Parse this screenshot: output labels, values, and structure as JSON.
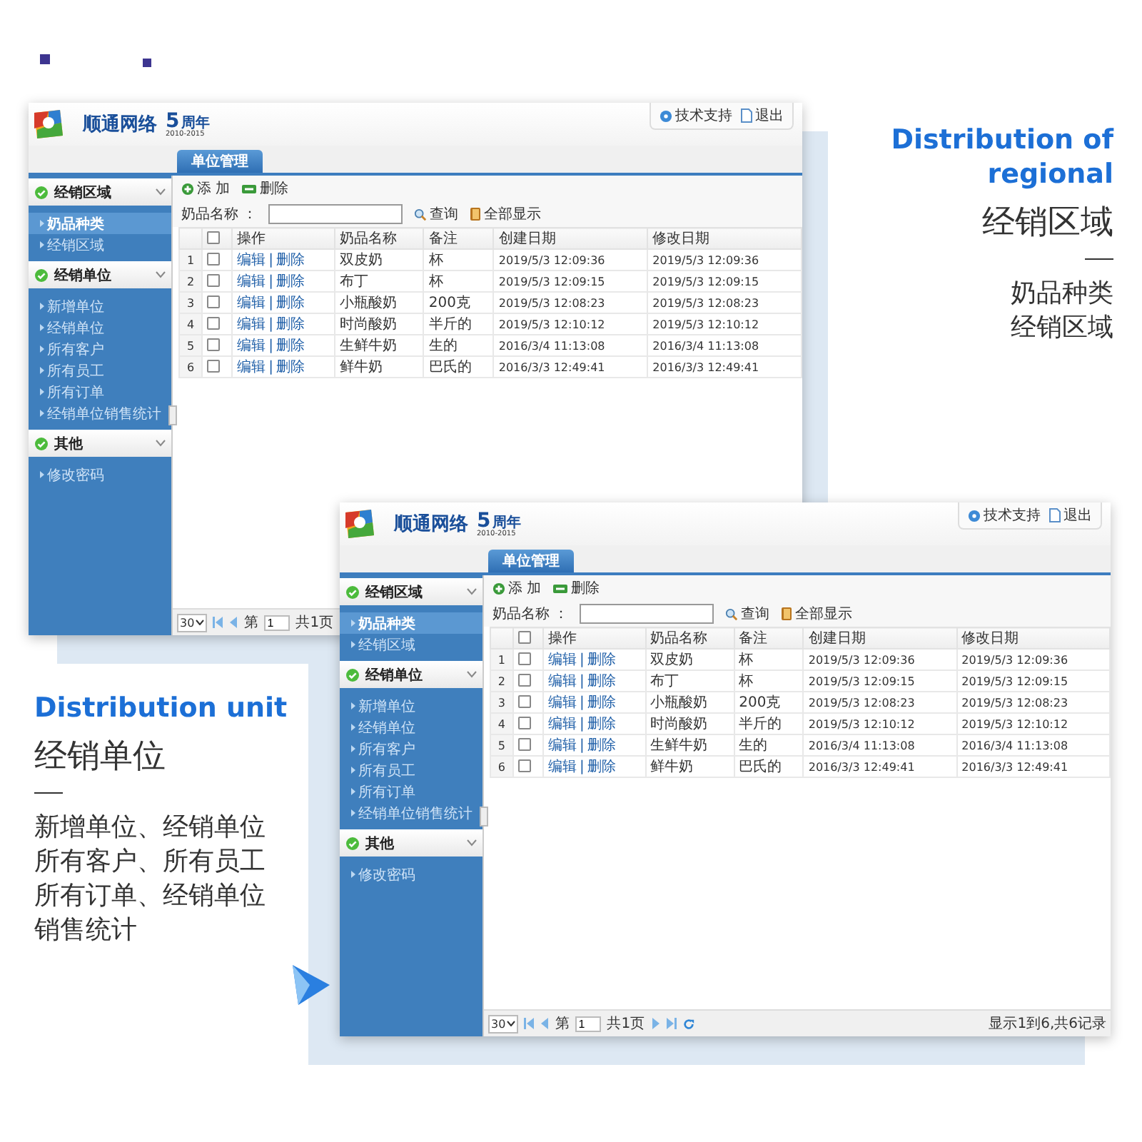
{
  "windows": [
    {
      "brand": {
        "name": "顺通网络",
        "number": "5",
        "label": "周年",
        "years": "2010-2015"
      },
      "header_links": [
        {
          "kind": "help",
          "label": "技术支持"
        },
        {
          "kind": "exit",
          "label": "退出"
        }
      ],
      "tabs": [
        {
          "label": "单位管理",
          "selected": true
        }
      ],
      "sidebar": [
        {
          "title": "经销区域",
          "expanded": true,
          "items": [
            {
              "label": "奶品种类",
              "selected": true
            },
            {
              "label": "经销区域",
              "selected": false
            }
          ]
        },
        {
          "title": "经销单位",
          "expanded": true,
          "items": [
            {
              "label": "新增单位",
              "selected": false
            },
            {
              "label": "经销单位",
              "selected": false
            },
            {
              "label": "所有客户",
              "selected": false
            },
            {
              "label": "所有员工",
              "selected": false
            },
            {
              "label": "所有订单",
              "selected": false
            },
            {
              "label": "经销单位销售统计",
              "selected": false
            }
          ]
        },
        {
          "title": "其他",
          "expanded": true,
          "items": [
            {
              "label": "修改密码",
              "selected": false
            }
          ]
        }
      ],
      "toolbar": {
        "buttons": [
          {
            "kind": "add",
            "label": "添 加"
          },
          {
            "kind": "delete",
            "label": "删除"
          }
        ],
        "search_label": "奶品名称 ：",
        "search_buttons": [
          {
            "kind": "search",
            "label": "查询"
          },
          {
            "kind": "show_all",
            "label": "全部显示"
          }
        ]
      },
      "table": {
        "columns": [
          "操作",
          "奶品名称",
          "备注",
          "创建日期",
          "修改日期"
        ],
        "header_checked": false,
        "action_separator": "|",
        "rows": [
          {
            "number": "1",
            "checked": false,
            "actions": [
              "编辑",
              "删除"
            ],
            "name": "双皮奶",
            "note": "杯",
            "created": "2019/5/3 12:09:36",
            "modified": "2019/5/3 12:09:36"
          },
          {
            "number": "2",
            "checked": false,
            "actions": [
              "编辑",
              "删除"
            ],
            "name": "布丁",
            "note": "杯",
            "created": "2019/5/3 12:09:15",
            "modified": "2019/5/3 12:09:15"
          },
          {
            "number": "3",
            "checked": false,
            "actions": [
              "编辑",
              "删除"
            ],
            "name": "小瓶酸奶",
            "note": "200克",
            "created": "2019/5/3 12:08:23",
            "modified": "2019/5/3 12:08:23"
          },
          {
            "number": "4",
            "checked": false,
            "actions": [
              "编辑",
              "删除"
            ],
            "name": "时尚酸奶",
            "note": "半斤的",
            "created": "2019/5/3 12:10:12",
            "modified": "2019/5/3 12:10:12"
          },
          {
            "number": "5",
            "checked": false,
            "actions": [
              "编辑",
              "删除"
            ],
            "name": "生鲜牛奶",
            "note": "生的",
            "created": "2016/3/4 11:13:08",
            "modified": "2016/3/4 11:13:08"
          },
          {
            "number": "6",
            "checked": false,
            "actions": [
              "编辑",
              "删除"
            ],
            "name": "鲜牛奶",
            "note": "巴氏的",
            "created": "2016/3/3 12:49:41",
            "modified": "2016/3/3 12:49:41"
          }
        ]
      },
      "footer": [
        {
          "kind": "page_size",
          "value": "30"
        },
        {
          "kind": "first"
        },
        {
          "kind": "prev"
        },
        {
          "kind": "page",
          "label": "第",
          "value": "1",
          "total": "共1页"
        }
      ]
    },
    {
      "brand": {
        "name": "顺通网络",
        "number": "5",
        "label": "周年",
        "years": "2010-2015"
      },
      "header_links": [
        {
          "kind": "help",
          "label": "技术支持"
        },
        {
          "kind": "exit",
          "label": "退出"
        }
      ],
      "tabs": [
        {
          "label": "单位管理",
          "selected": true
        }
      ],
      "sidebar": [
        {
          "title": "经销区域",
          "expanded": true,
          "items": [
            {
              "label": "奶品种类",
              "selected": true
            },
            {
              "label": "经销区域",
              "selected": false
            }
          ]
        },
        {
          "title": "经销单位",
          "expanded": true,
          "items": [
            {
              "label": "新增单位",
              "selected": false
            },
            {
              "label": "经销单位",
              "selected": false
            },
            {
              "label": "所有客户",
              "selected": false
            },
            {
              "label": "所有员工",
              "selected": false
            },
            {
              "label": "所有订单",
              "selected": false
            },
            {
              "label": "经销单位销售统计",
              "selected": false
            }
          ]
        },
        {
          "title": "其他",
          "expanded": true,
          "items": [
            {
              "label": "修改密码",
              "selected": false
            }
          ]
        }
      ],
      "toolbar": {
        "buttons": [
          {
            "kind": "add",
            "label": "添 加"
          },
          {
            "kind": "delete",
            "label": "删除"
          }
        ],
        "search_label": "奶品名称 ：",
        "search_buttons": [
          {
            "kind": "search",
            "label": "查询"
          },
          {
            "kind": "show_all",
            "label": "全部显示"
          }
        ]
      },
      "table": {
        "columns": [
          "操作",
          "奶品名称",
          "备注",
          "创建日期",
          "修改日期"
        ],
        "header_checked": false,
        "action_separator": "|",
        "rows": [
          {
            "number": "1",
            "checked": false,
            "actions": [
              "编辑",
              "删除"
            ],
            "name": "双皮奶",
            "note": "杯",
            "created": "2019/5/3 12:09:36",
            "modified": "2019/5/3 12:09:36"
          },
          {
            "number": "2",
            "checked": false,
            "actions": [
              "编辑",
              "删除"
            ],
            "name": "布丁",
            "note": "杯",
            "created": "2019/5/3 12:09:15",
            "modified": "2019/5/3 12:09:15"
          },
          {
            "number": "3",
            "checked": false,
            "actions": [
              "编辑",
              "删除"
            ],
            "name": "小瓶酸奶",
            "note": "200克",
            "created": "2019/5/3 12:08:23",
            "modified": "2019/5/3 12:08:23"
          },
          {
            "number": "4",
            "checked": false,
            "actions": [
              "编辑",
              "删除"
            ],
            "name": "时尚酸奶",
            "note": "半斤的",
            "created": "2019/5/3 12:10:12",
            "modified": "2019/5/3 12:10:12"
          },
          {
            "number": "5",
            "checked": false,
            "actions": [
              "编辑",
              "删除"
            ],
            "name": "生鲜牛奶",
            "note": "生的",
            "created": "2016/3/4 11:13:08",
            "modified": "2016/3/4 11:13:08"
          },
          {
            "number": "6",
            "checked": false,
            "actions": [
              "编辑",
              "删除"
            ],
            "name": "鲜牛奶",
            "note": "巴氏的",
            "created": "2016/3/3 12:49:41",
            "modified": "2016/3/3 12:49:41"
          }
        ]
      },
      "footer": [
        {
          "kind": "page_size",
          "value": "30"
        },
        {
          "kind": "first"
        },
        {
          "kind": "prev"
        },
        {
          "kind": "page",
          "label": "第",
          "value": "1",
          "total": "共1页"
        },
        {
          "kind": "next"
        },
        {
          "kind": "last"
        },
        {
          "kind": "refresh"
        },
        {
          "kind": "summary",
          "text": "显示1到6,共6记录"
        }
      ]
    }
  ],
  "captions": [
    {
      "title": "Distribution of regional",
      "subtitle": "经销区域",
      "lines": [
        "奶品种类",
        "经销区域"
      ]
    },
    {
      "title": "Distribution unit",
      "subtitle": "经销单位",
      "lines": [
        "新增单位、经销单位",
        "所有客户、所有员工",
        "所有订单、经销单位",
        "销售统计"
      ]
    }
  ]
}
